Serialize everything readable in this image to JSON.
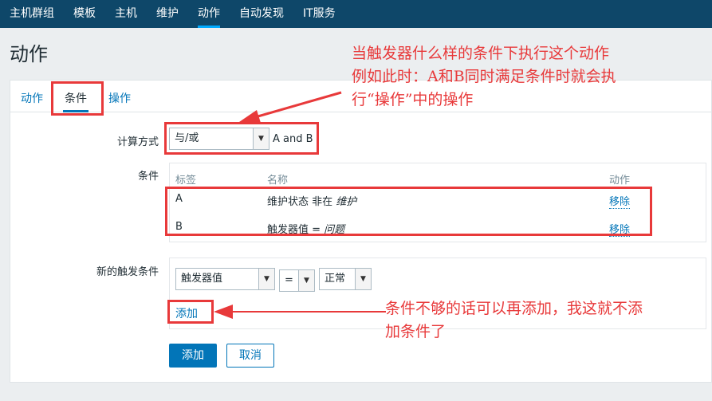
{
  "nav": {
    "items": [
      {
        "label": "主机群组"
      },
      {
        "label": "模板"
      },
      {
        "label": "主机"
      },
      {
        "label": "维护"
      },
      {
        "label": "动作",
        "active": true
      },
      {
        "label": "自动发现"
      },
      {
        "label": "IT服务"
      }
    ]
  },
  "page_title": "动作",
  "tabs": [
    {
      "label": "动作"
    },
    {
      "label": "条件",
      "active": true
    },
    {
      "label": "操作"
    }
  ],
  "calc": {
    "label": "计算方式",
    "value": "与/或",
    "formula": "A and B"
  },
  "conditions": {
    "label": "条件",
    "headers": {
      "tag": "标签",
      "name": "名称",
      "action": "动作"
    },
    "rows": [
      {
        "tag": "A",
        "name_prefix": "维护状态 非在 ",
        "name_value": "维护",
        "action": "移除"
      },
      {
        "tag": "B",
        "name_prefix": "触发器值 = ",
        "name_value": "问题",
        "action": "移除"
      }
    ]
  },
  "new_condition": {
    "label": "新的触发条件",
    "type_value": "触发器值",
    "operator_value": "=",
    "value_value": "正常",
    "add_link": "添加"
  },
  "buttons": {
    "add": "添加",
    "cancel": "取消"
  },
  "annotations": {
    "top_note": [
      "当触发器什么样的条件下执行这个动作",
      "例如此时：A和B同时满足条件时就会执",
      "行“操作”中的操作"
    ],
    "bottom_note": [
      "条件不够的话可以再添加，我这就不添",
      "加条件了"
    ]
  },
  "colors": {
    "nav_bg": "#0e4769",
    "accent": "#0275b8",
    "annotation_red": "#e8393a"
  }
}
